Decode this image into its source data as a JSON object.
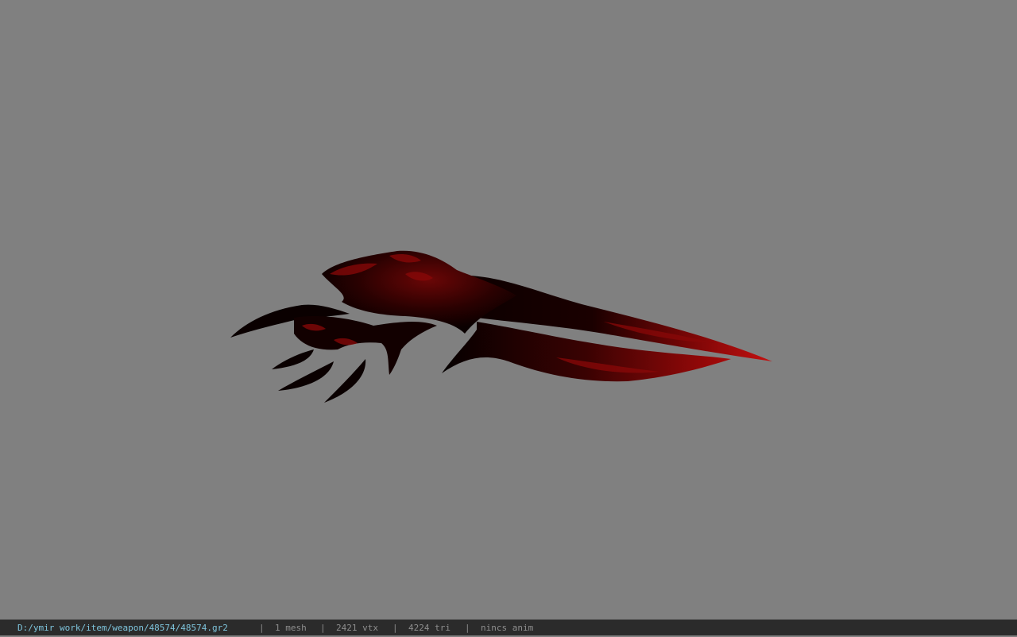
{
  "viewer": {
    "background_color": "#808080",
    "model_name": "red-black-claw-weapon"
  },
  "statusbar": {
    "file_path": "D:/ymir work/item/weapon/48574/48574.gr2",
    "separator": "|",
    "mesh_count": "1 mesh",
    "vertex_count": "2421 vtx",
    "triangle_count": "4224 tri",
    "anim_info": "nincs anim",
    "path_color": "#7ec4dc",
    "bar_color": "#2b2b2b"
  }
}
